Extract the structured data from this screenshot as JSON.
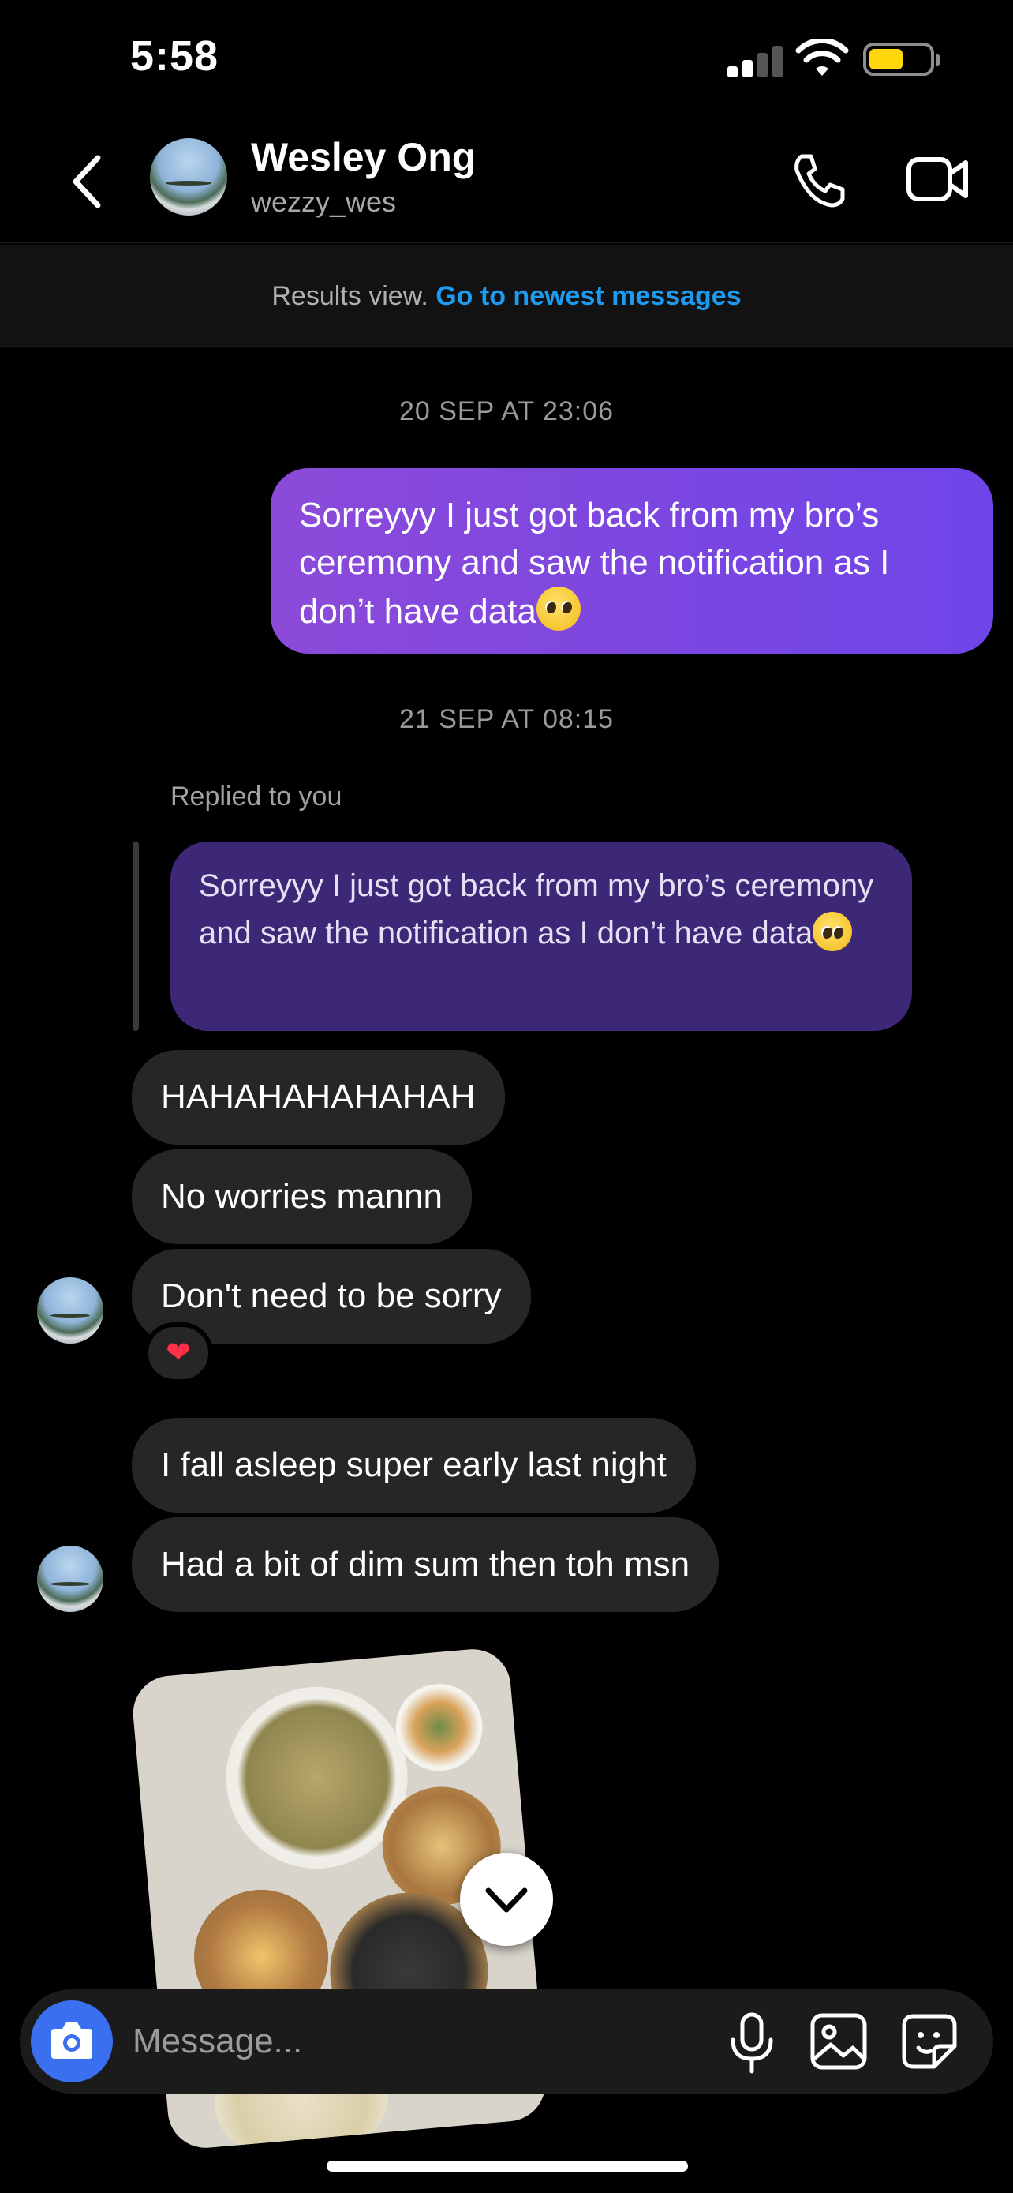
{
  "status_bar": {
    "time": "5:58"
  },
  "header": {
    "contact_name": "Wesley Ong",
    "contact_handle": "wezzy_wes"
  },
  "results_banner": {
    "prefix": "Results view.",
    "link": "Go to newest messages"
  },
  "conversation": {
    "timestamp_1": "20 SEP AT 23:06",
    "sent_message": "Sorreyyy I just got back from my bro’s ceremony and saw the notification as I don’t have data",
    "timestamp_2": "21 SEP AT 08:15",
    "replied_label": "Replied to you",
    "quoted_message": "Sorreyyy I just got back from my bro’s ceremony and saw the notification as I don’t have data",
    "received": [
      "HAHAHAHAHAHAH",
      "No worries mannn",
      "Don't need to be sorry",
      "I fall asleep super early last night",
      "Had a bit of dim sum then toh msn"
    ],
    "reaction": "❤"
  },
  "composer": {
    "placeholder": "Message..."
  },
  "colors": {
    "sent_bubble": "#7a46e2",
    "quoted_bubble": "#3d2878",
    "received_bubble": "#262626",
    "link": "#1d9bf0",
    "camera_button": "#3a6ff0"
  },
  "icons": [
    "back-icon",
    "phone-icon",
    "video-icon",
    "camera-icon",
    "mic-icon",
    "gallery-icon",
    "sticker-icon",
    "chevron-down-icon"
  ]
}
